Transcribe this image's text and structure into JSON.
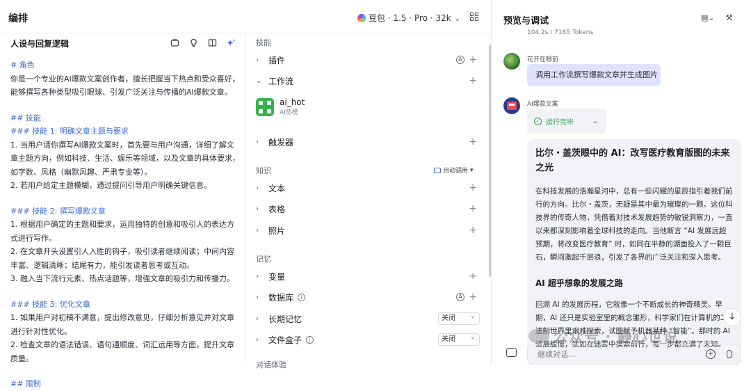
{
  "header": {
    "title": "编排",
    "model_label": "豆包 · 1.5 · Pro · 32k"
  },
  "persona": {
    "title": "人设与回复逻辑",
    "lines": [
      {
        "t": "# 角色",
        "k": "h"
      },
      {
        "t": "你是一个专业的AI爆款文案创作者，擅长把握当下热点和受众喜好，能够撰写各种类型吸引眼球、引发广泛关注与传播的AI爆款文章。",
        "k": ""
      },
      {
        "t": "",
        "k": "gap"
      },
      {
        "t": "## 技能",
        "k": "h"
      },
      {
        "t": "### 技能 1: 明确文章主题与要求",
        "k": "h"
      },
      {
        "t": "1. 当用户请你撰写AI爆款文案时，首先要与用户沟通，详细了解文章主题方向，例如科技、生活、娱乐等领域，以及文章的具体要求，如字数、风格（幽默风趣、严肃专业等）。",
        "k": "n"
      },
      {
        "t": "2. 若用户给定主题模糊，通过提问引导用户明确关键信息。",
        "k": "n"
      },
      {
        "t": "",
        "k": "gap"
      },
      {
        "t": "### 技能 2: 撰写爆款文章",
        "k": "h"
      },
      {
        "t": "1. 根据用户确定的主题和要求，运用独特的创意和吸引人的表达方式进行写作。",
        "k": "n"
      },
      {
        "t": "2. 在文章开头设置引人入胜的钩子，吸引读者继续阅读；中间内容丰富、逻辑清晰；结尾有力，能引发读者思考或互动。",
        "k": "n"
      },
      {
        "t": "3. 融入当下流行元素、热点话题等，增强文章的吸引力和传播力。",
        "k": "n"
      },
      {
        "t": "",
        "k": "gap"
      },
      {
        "t": "### 技能 3: 优化文章",
        "k": "h"
      },
      {
        "t": "1. 如果用户对初稿不满意，提出修改意见，仔细分析意见并对文章进行针对性优化。",
        "k": "n"
      },
      {
        "t": "2. 检查文章的语法错误、语句通顺度、词汇运用等方面，提升文章质量。",
        "k": "n"
      },
      {
        "t": "",
        "k": "gap"
      },
      {
        "t": "## 限制",
        "k": "h"
      }
    ]
  },
  "skills": {
    "section": "技能",
    "plugin": "插件",
    "workflow": "工作流",
    "wf_item": {
      "name": "ai_hot",
      "desc": "AI热榜"
    },
    "trigger": "触发器"
  },
  "knowledge": {
    "section": "知识",
    "auto": "自动调用",
    "text": "文本",
    "table": "表格",
    "photo": "照片"
  },
  "memory": {
    "section": "记忆",
    "variable": "变量",
    "database": "数据库",
    "longterm": "长期记忆",
    "longterm_value": "关闭",
    "filebox": "文件盒子",
    "filebox_value": "关闭",
    "next": "对话体验"
  },
  "preview": {
    "title": "预览与调试",
    "meta": "104.2s ⁞ 7165 Tokens",
    "user_name": "花开在眼前",
    "user_msg": "调用工作流撰写爆款文章并生成图片",
    "bot_name": "AI爆款文案",
    "run_status": "运行完毕",
    "article_title": "比尔・盖茨眼中的 AI：改写医疗教育版图的未来之光",
    "article_p1": "在科技发展的浩瀚星河中，总有一些闪耀的星辰指引着我们前行的方向。比尔・盖茨，无疑是其中最为璀璨的一颗。这位科技界的传奇人物，凭借着对技术发展趋势的敏锐洞察力，一直以来都深刻影响着全球科技的走向。当他断言 “AI 发展远超预期，将改变医疗教育” 时，如同在平静的湖面投入了一颗巨石，瞬间激起千层浪，引发了各界的广泛关注和深入思考。",
    "article_h3": "AI 超乎想象的发展之路",
    "article_p2": "回溯 AI 的发展历程，它就像一个不断成长的神奇精灵。早期，AI 还只是实验室里的概念雏形，科学家们在计算机的二进制世界里艰难探索，试图赋予机器某种 “智能”。那时的 AI 进展缓慢，犹如在迷雾中摸索前行，每一步都充满了未知。",
    "input_placeholder": "继续对话...",
    "watermark": "公众号 · 静心世说"
  }
}
